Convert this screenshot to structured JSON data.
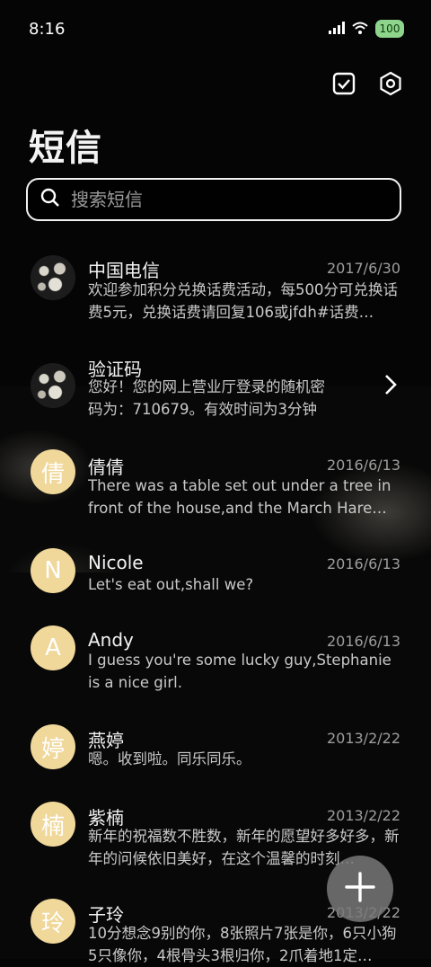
{
  "status_bar": {
    "time": "8:16",
    "battery": "100"
  },
  "header": {
    "title": "短信"
  },
  "search": {
    "placeholder": "搜索短信"
  },
  "conversations": [
    {
      "avatar_text": "",
      "name": "中国电信",
      "date": "2017/6/30",
      "preview": "欢迎参加积分兑换话费活动，每500分可兑换话费5元，兑换话费请回复106或jfdh#话费…"
    },
    {
      "avatar_text": "",
      "name": "验证码",
      "date": "",
      "preview": "您好！您的网上营业厅登录的随机密码为：710679。有效时间为3分钟"
    },
    {
      "avatar_text": "倩",
      "name": "倩倩",
      "date": "2016/6/13",
      "preview": "There was a table set out under a tree in front of the house,and the March Hare an…"
    },
    {
      "avatar_text": "N",
      "name": "Nicole",
      "date": "2016/6/13",
      "preview": "Let's eat out,shall we?"
    },
    {
      "avatar_text": "A",
      "name": "Andy",
      "date": "2016/6/13",
      "preview": "I guess you're some lucky guy,Stephanie is a nice girl."
    },
    {
      "avatar_text": "婷",
      "name": "燕婷",
      "date": "2013/2/22",
      "preview": "嗯。收到啦。同乐同乐。"
    },
    {
      "avatar_text": "楠",
      "name": "紫楠",
      "date": "2013/2/22",
      "preview": "新年的祝福数不胜数，新年的愿望好多好多，新年的问候依旧美好，在这个温馨的时刻…"
    },
    {
      "avatar_text": "玲",
      "name": "子玲",
      "date": "2013/2/22",
      "preview": "10分想念9别的你，8张照片7张是你，6只小狗5只像你，4根骨头3根归你，2爪着地1定…"
    }
  ],
  "icons": {
    "select": "checkbox-icon",
    "settings": "settings-icon",
    "search": "search-icon",
    "compose": "plus-icon",
    "chevron": "chevron-right-icon"
  },
  "colors": {
    "avatar": "#f0d79a",
    "battery": "#8fd48c"
  }
}
